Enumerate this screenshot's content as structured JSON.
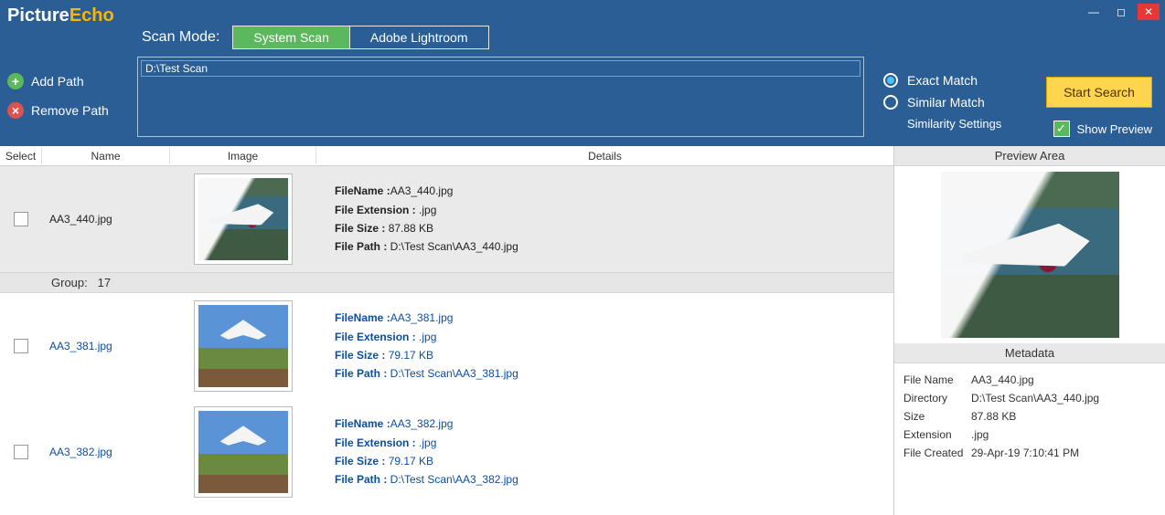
{
  "app": {
    "logo_a": "Picture",
    "logo_b": "Echo"
  },
  "header": {
    "scan_mode_label": "Scan Mode:",
    "tabs": {
      "system": "System Scan",
      "lightroom": "Adobe Lightroom"
    },
    "path_value": "D:\\Test Scan",
    "actions": {
      "add": "Add Path",
      "remove": "Remove Path"
    },
    "match": {
      "exact": "Exact Match",
      "similar": "Similar Match",
      "settings": "Similarity Settings"
    },
    "start": "Start Search",
    "show_preview": "Show Preview"
  },
  "grid": {
    "headers": {
      "select": "Select",
      "name": "Name",
      "image": "Image",
      "details": "Details"
    },
    "group_label": "Group:",
    "group_number": "17",
    "detail_labels": {
      "filename": "FileName :",
      "ext": "File Extension :",
      "size": "File Size :",
      "path": "File Path  :"
    },
    "rows": [
      {
        "name": "AA3_440.jpg",
        "filename": "AA3_440.jpg",
        "ext": " .jpg",
        "size": " 87.88 KB",
        "path": " D:\\Test Scan\\AA3_440.jpg",
        "selected": true,
        "scene": "river"
      },
      {
        "name": "AA3_381.jpg",
        "filename": "AA3_381.jpg",
        "ext": " .jpg",
        "size": " 79.17 KB",
        "path": " D:\\Test Scan\\AA3_381.jpg",
        "selected": false,
        "scene": "landing"
      },
      {
        "name": "AA3_382.jpg",
        "filename": "AA3_382.jpg",
        "ext": " .jpg",
        "size": " 79.17 KB",
        "path": " D:\\Test Scan\\AA3_382.jpg",
        "selected": false,
        "scene": "landing"
      }
    ]
  },
  "sidebar": {
    "preview_header": "Preview Area",
    "metadata_header": "Metadata",
    "metadata": [
      {
        "k": "File Name",
        "v": "AA3_440.jpg"
      },
      {
        "k": "Directory",
        "v": "D:\\Test Scan\\AA3_440.jpg"
      },
      {
        "k": "Size",
        "v": "87.88 KB"
      },
      {
        "k": "Extension",
        "v": ".jpg"
      },
      {
        "k": "File Created",
        "v": "29-Apr-19 7:10:41 PM"
      }
    ]
  }
}
